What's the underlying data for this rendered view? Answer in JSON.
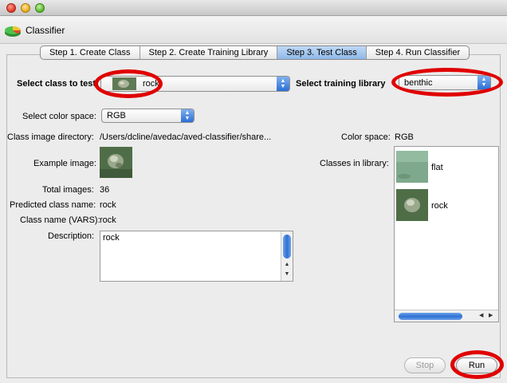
{
  "window": {
    "title_bar": ""
  },
  "app": {
    "title": "Classifier",
    "icon": "pie-chart-icon"
  },
  "tabs": [
    {
      "label": "Step 1. Create Class",
      "active": false
    },
    {
      "label": "Step 2. Create Training Library",
      "active": false
    },
    {
      "label": "Step 3. Test Class",
      "active": true
    },
    {
      "label": "Step 4. Run Classifier",
      "active": false
    }
  ],
  "form": {
    "select_class_label": "Select class to test",
    "select_class_value": "rock",
    "select_library_label": "Select training library",
    "select_library_value": "benthic",
    "color_space_label": "Select color space:",
    "color_space_value": "RGB",
    "class_dir_label": "Class image directory:",
    "class_dir_value": "/Users/dcline/avedac/aved-classifier/share...",
    "color_space_info_label": "Color space:",
    "color_space_info_value": "RGB",
    "example_image_label": "Example image:",
    "classes_in_library_label": "Classes in library:",
    "total_images_label": "Total images:",
    "total_images_value": "36",
    "predicted_class_label": "Predicted class name:",
    "predicted_class_value": "rock",
    "class_name_vars_label": "Class name (VARS):",
    "class_name_vars_value": "rock",
    "description_label": "Description:",
    "description_value": "rock"
  },
  "library_classes": [
    {
      "name": "flat"
    },
    {
      "name": "rock"
    }
  ],
  "buttons": {
    "stop": "Stop",
    "run": "Run"
  },
  "colors": {
    "annotation": "#e00000",
    "accent": "#2c6fd6"
  }
}
